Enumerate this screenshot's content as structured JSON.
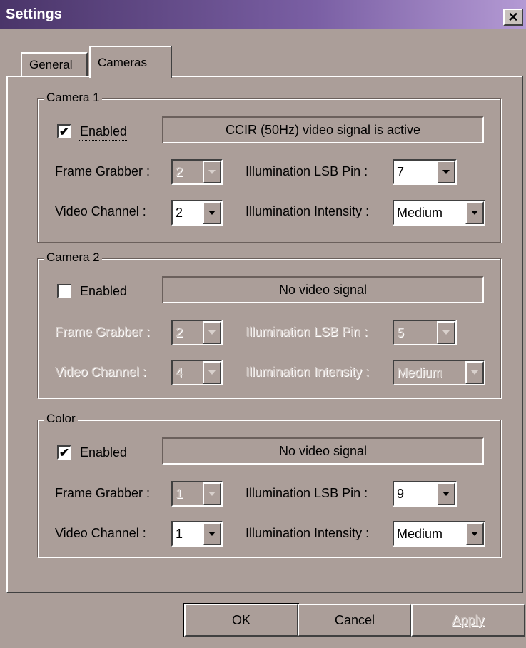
{
  "window": {
    "title": "Settings",
    "close_glyph": "✕"
  },
  "tabs": [
    {
      "label": "General",
      "active": false
    },
    {
      "label": "Cameras",
      "active": true
    }
  ],
  "groups": [
    {
      "legend": "Camera 1",
      "enabled_label": "Enabled",
      "enabled": true,
      "status": "CCIR (50Hz) video signal is active",
      "frame_grabber_label": "Frame Grabber :",
      "frame_grabber_value": "2",
      "video_channel_label": "Video Channel :",
      "video_channel_value": "2",
      "lsb_pin_label": "Illumination LSB Pin :",
      "lsb_pin_value": "7",
      "intensity_label": "Illumination Intensity :",
      "intensity_value": "Medium"
    },
    {
      "legend": "Camera 2",
      "enabled_label": "Enabled",
      "enabled": false,
      "status": "No video signal",
      "frame_grabber_label": "Frame Grabber :",
      "frame_grabber_value": "2",
      "video_channel_label": "Video Channel :",
      "video_channel_value": "4",
      "lsb_pin_label": "Illumination LSB Pin :",
      "lsb_pin_value": "5",
      "intensity_label": "Illumination Intensity :",
      "intensity_value": "Medium"
    },
    {
      "legend": "Color",
      "enabled_label": "Enabled",
      "enabled": true,
      "status": "No video signal",
      "frame_grabber_label": "Frame Grabber :",
      "frame_grabber_value": "1",
      "video_channel_label": "Video Channel :",
      "video_channel_value": "1",
      "lsb_pin_label": "Illumination LSB Pin :",
      "lsb_pin_value": "9",
      "intensity_label": "Illumination Intensity :",
      "intensity_value": "Medium"
    }
  ],
  "check_glyph": "✔",
  "buttons": {
    "ok": "OK",
    "cancel": "Cancel",
    "apply": "Apply"
  },
  "colors": {
    "dialog_bg": "#ab9e99",
    "title_start": "#4a3569",
    "title_end": "#b49ad4"
  }
}
